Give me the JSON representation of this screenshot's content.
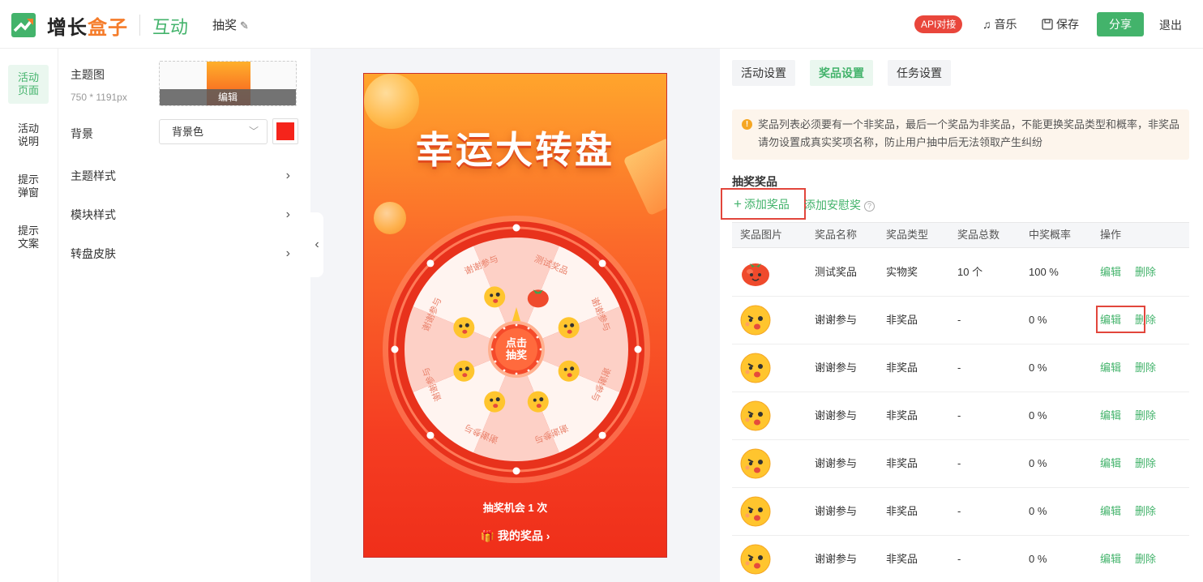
{
  "header": {
    "logo_text_a": "增长",
    "logo_text_b": "盒子",
    "module": "互动",
    "crumb": "抽奖",
    "api_badge": "API对接",
    "music": "音乐",
    "save": "保存",
    "share": "分享",
    "logout": "退出"
  },
  "left_nav": [
    {
      "label": "活动\n页面",
      "active": true
    },
    {
      "label": "活动\n说明"
    },
    {
      "label": "提示\n弹窗"
    },
    {
      "label": "提示\n文案"
    }
  ],
  "settings": {
    "theme_image_label": "主题图",
    "theme_image_size": "750 * 1191px",
    "theme_edit": "编辑",
    "background_label": "背景",
    "background_select": "背景色",
    "background_color": "#f5241b",
    "rows": [
      "主题样式",
      "模块样式",
      "转盘皮肤"
    ]
  },
  "preview": {
    "title": "幸运大转盘",
    "center_button": "点击\n抽奖",
    "segments": [
      "测试奖品",
      "谢谢参与",
      "谢谢参与",
      "谢谢参与",
      "谢谢参与",
      "谢谢参与",
      "谢谢参与",
      "谢谢参与"
    ],
    "chances": "抽奖机会 1 次",
    "my_prize": "我的奖品"
  },
  "right": {
    "tabs": [
      "活动设置",
      "奖品设置",
      "任务设置"
    ],
    "active_tab": "奖品设置",
    "notice": "奖品列表必须要有一个非奖品，最后一个奖品为非奖品，不能更换奖品类型和概率，非奖品请勿设置成真实奖项名称，防止用户抽中后无法领取产生纠纷",
    "section_title": "抽奖奖品",
    "add_prize": "添加奖品",
    "add_consolation": "添加安慰奖",
    "columns": [
      "奖品图片",
      "奖品名称",
      "奖品类型",
      "奖品总数",
      "中奖概率",
      "操作"
    ],
    "rows": [
      {
        "icon": "tomato",
        "name": "测试奖品",
        "type": "实物奖",
        "total": "10 个",
        "rate": "100 %"
      },
      {
        "icon": "emoji",
        "name": "谢谢参与",
        "type": "非奖品",
        "total": "-",
        "rate": "0 %"
      },
      {
        "icon": "emoji",
        "name": "谢谢参与",
        "type": "非奖品",
        "total": "-",
        "rate": "0 %"
      },
      {
        "icon": "emoji",
        "name": "谢谢参与",
        "type": "非奖品",
        "total": "-",
        "rate": "0 %"
      },
      {
        "icon": "emoji",
        "name": "谢谢参与",
        "type": "非奖品",
        "total": "-",
        "rate": "0 %"
      },
      {
        "icon": "emoji",
        "name": "谢谢参与",
        "type": "非奖品",
        "total": "-",
        "rate": "0 %"
      },
      {
        "icon": "emoji",
        "name": "谢谢参与",
        "type": "非奖品",
        "total": "-",
        "rate": "0 %"
      }
    ],
    "edit": "编辑",
    "delete": "删除"
  },
  "colors": {
    "accent": "#43b36b",
    "brand_orange": "#f57c2a",
    "danger": "#e2463c"
  }
}
